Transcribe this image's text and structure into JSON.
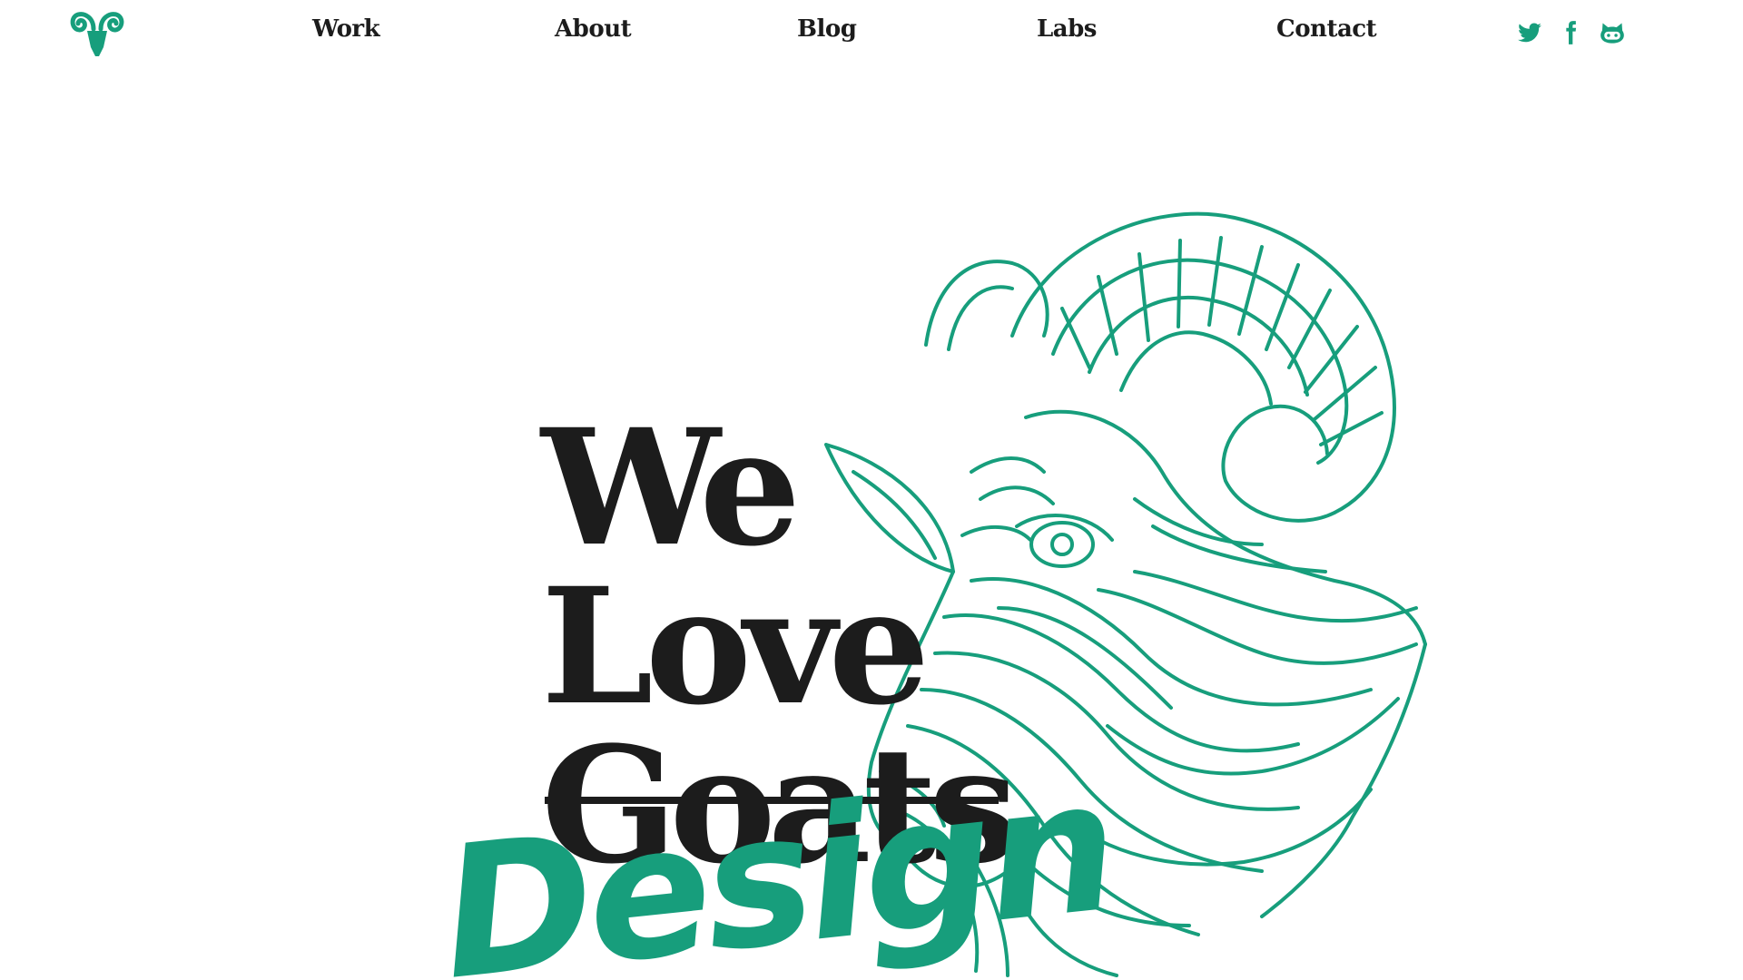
{
  "colors": {
    "accent": "#179e7c",
    "text": "#1c1c1c",
    "background": "#ffffff"
  },
  "header": {
    "logo_icon": "ram-head-logo-icon",
    "nav": [
      {
        "label": "Work"
      },
      {
        "label": "About"
      },
      {
        "label": "Blog"
      },
      {
        "label": "Labs"
      },
      {
        "label": "Contact"
      }
    ],
    "social": [
      {
        "icon": "twitter-icon"
      },
      {
        "icon": "facebook-icon"
      },
      {
        "icon": "github-icon"
      }
    ]
  },
  "hero": {
    "line1": "We",
    "line2": "Love",
    "line3_struck": "Goats",
    "handwritten": "Design",
    "illustration_icon": "goat-head-illustration"
  }
}
